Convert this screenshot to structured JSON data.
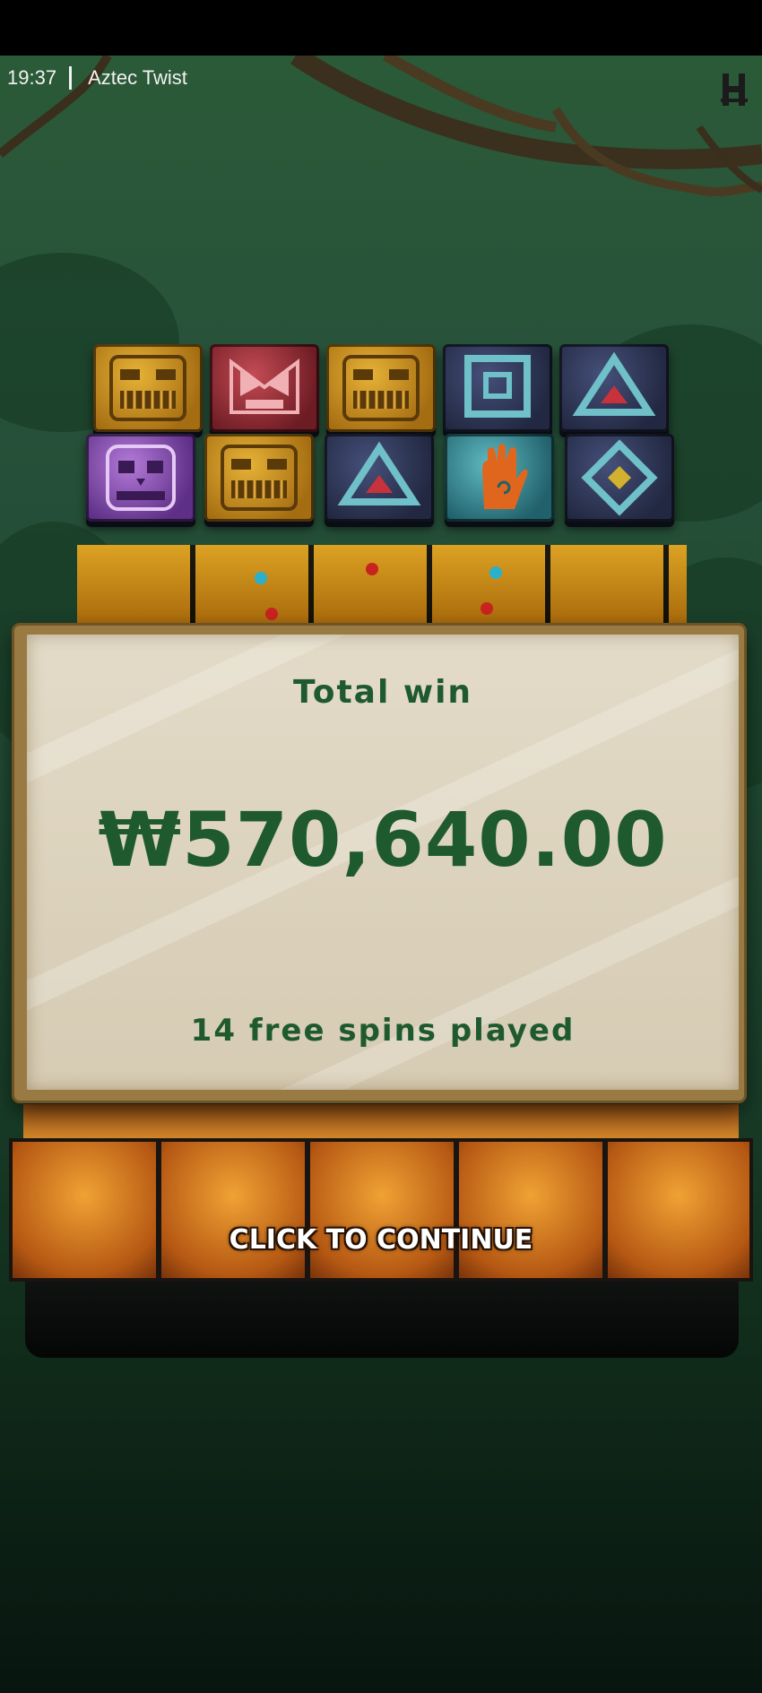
{
  "status_bar": {
    "time": "19:37",
    "game_title": "Aztec Twist"
  },
  "icons": {
    "brand_logo": "hacksaw-logo-icon"
  },
  "board": {
    "row1": [
      "gold-mask-symbol",
      "red-mask-symbol",
      "gold-mask-symbol",
      "square-glyph-symbol",
      "triangle-glyph-symbol"
    ],
    "row2": [
      "purple-skull-symbol",
      "gold-mask-symbol",
      "triangle-glyph-symbol",
      "hand-glyph-symbol",
      "diamond-glyph-symbol"
    ]
  },
  "win_panel": {
    "title": "Total win",
    "amount": "₩570,640.00",
    "subtitle": "14 free spins played"
  },
  "continue_label": "CLICK TO CONTINUE",
  "colors": {
    "panel_text": "#1f5a2e",
    "background": "#27523a"
  }
}
